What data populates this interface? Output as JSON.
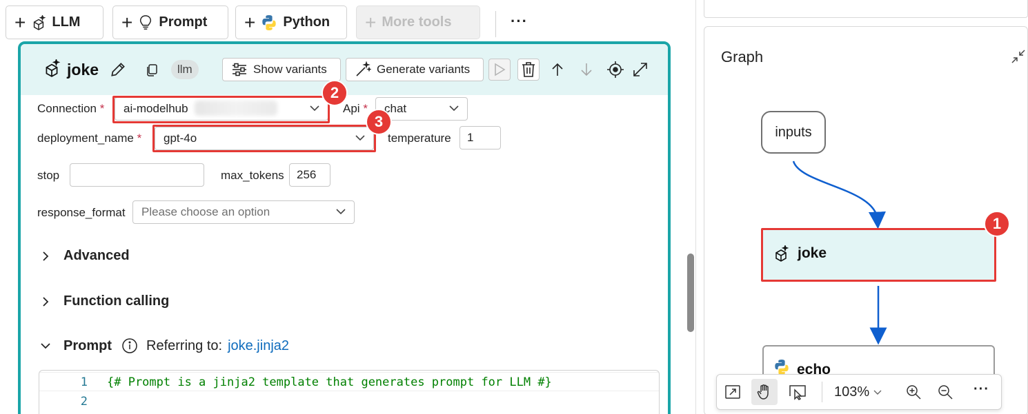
{
  "toolbar": {
    "llm_label": "LLM",
    "prompt_label": "Prompt",
    "python_label": "Python",
    "more_tools_label": "More tools",
    "overflow": "···"
  },
  "node": {
    "title": "joke",
    "badge": "llm",
    "show_variants": "Show variants",
    "generate_variants": "Generate variants"
  },
  "fields": {
    "connection_label": "Connection",
    "connection_value": "ai-modelhub",
    "api_label": "Api",
    "api_value": "chat",
    "deployment_label": "deployment_name",
    "deployment_value": "gpt-4o",
    "temperature_label": "temperature",
    "temperature_value": "1",
    "stop_label": "stop",
    "stop_value": "",
    "max_tokens_label": "max_tokens",
    "max_tokens_value": "256",
    "response_format_label": "response_format",
    "response_format_placeholder": "Please choose an option",
    "required_mark": "*"
  },
  "sections": {
    "advanced": "Advanced",
    "function_calling": "Function calling",
    "prompt": "Prompt",
    "referring_to": "Referring to:",
    "prompt_file": "joke.jinja2"
  },
  "editor": {
    "lines": [
      {
        "num": "1",
        "code": "{# Prompt is a jinja2 template that generates prompt for LLM #}"
      },
      {
        "num": "2",
        "code": ""
      }
    ]
  },
  "callouts": {
    "one": "1",
    "two": "2",
    "three": "3"
  },
  "graph": {
    "title": "Graph",
    "nodes": {
      "inputs": "inputs",
      "joke": "joke",
      "echo": "echo"
    },
    "zoom": "103%",
    "more": "···"
  },
  "colors": {
    "accent_teal": "#1ba5a8",
    "node_bg": "#e3f5f5",
    "highlight_red": "#e53935",
    "edge_blue": "#0f5fcf",
    "link_blue": "#0f6cbd"
  },
  "icons": {
    "llm": "sparkle-cube-icon",
    "prompt": "lightbulb-icon",
    "python": "python-icon",
    "edit": "pencil-icon",
    "copy": "copy-icon",
    "run": "play-icon",
    "delete": "trash-icon",
    "up": "arrow-up-icon",
    "down": "arrow-down-icon",
    "locate": "target-icon",
    "expand": "expand-icon"
  }
}
